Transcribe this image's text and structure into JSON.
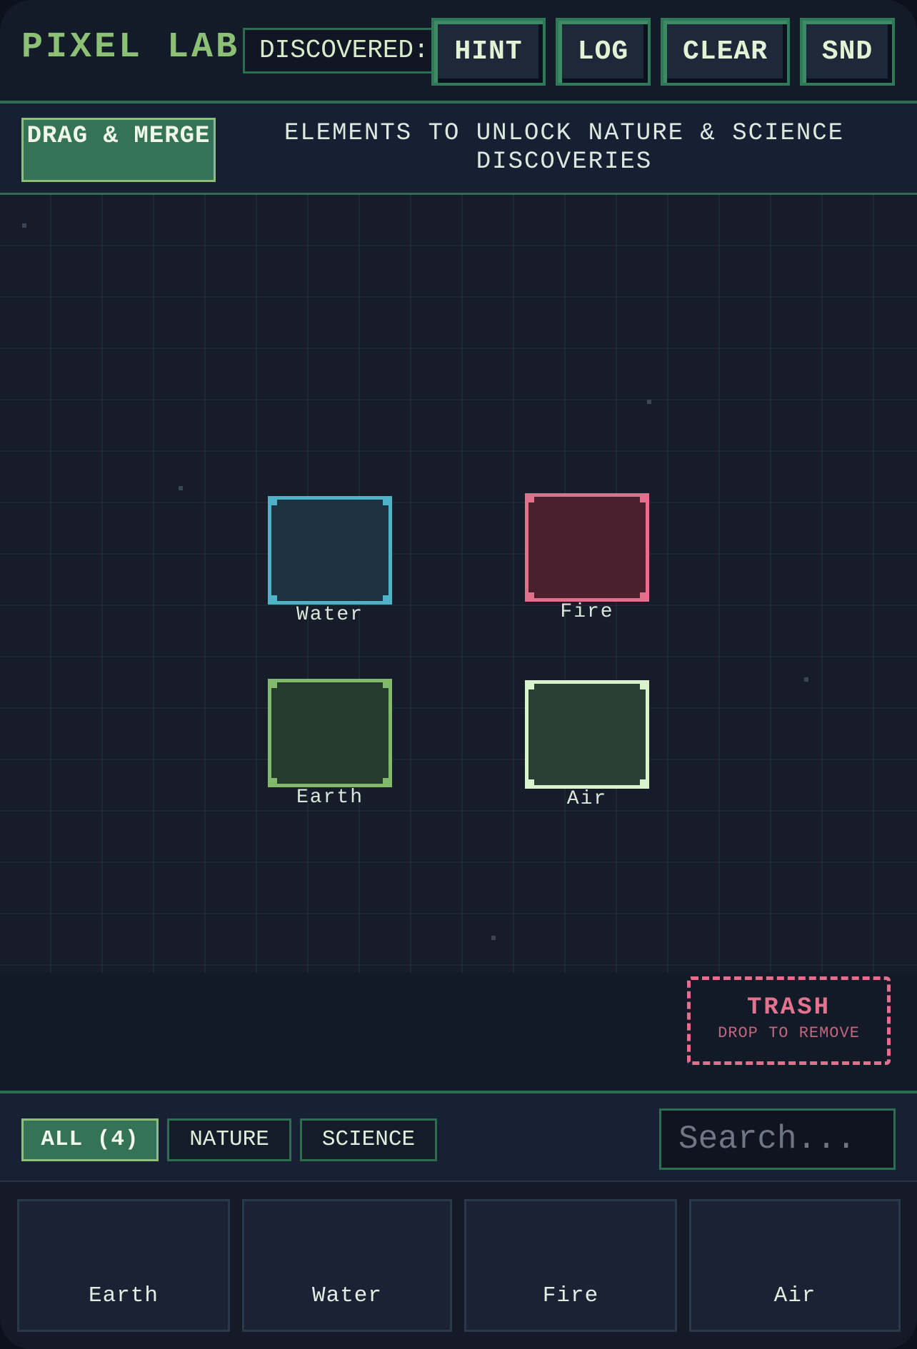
{
  "header": {
    "title": "PIXEL LAB",
    "discovered_label": "DISCOVERED:",
    "buttons": {
      "hint": "HINT",
      "log": "LOG",
      "clear": "CLEAR",
      "sound": "SND"
    }
  },
  "instruction": {
    "badge": "DRAG & MERGE",
    "text": "ELEMENTS TO UNLOCK NATURE & SCIENCE DISCOVERIES"
  },
  "board": {
    "tiles": [
      {
        "name": "Water",
        "border_color": "#4fb3c8",
        "fill_color": "#1e3342"
      },
      {
        "name": "Fire",
        "border_color": "#e0708b",
        "fill_color": "#4a202e"
      },
      {
        "name": "Earth",
        "border_color": "#82b96a",
        "fill_color": "#243b2e"
      },
      {
        "name": "Air",
        "border_color": "#d9f3cd",
        "fill_color": "#2a3f36"
      }
    ]
  },
  "trash": {
    "title": "TRASH",
    "subtitle": "DROP TO REMOVE"
  },
  "filters": {
    "tabs": [
      {
        "label": "ALL (4)",
        "active": true
      },
      {
        "label": "NATURE",
        "active": false
      },
      {
        "label": "SCIENCE",
        "active": false
      }
    ],
    "search_placeholder": "Search..."
  },
  "inventory": {
    "items": [
      "Earth",
      "Water",
      "Fire",
      "Air"
    ]
  },
  "colors": {
    "accent": "#2e6e50",
    "accent_light": "#8cc074",
    "background": "#141a28",
    "danger": "#e0708b"
  }
}
